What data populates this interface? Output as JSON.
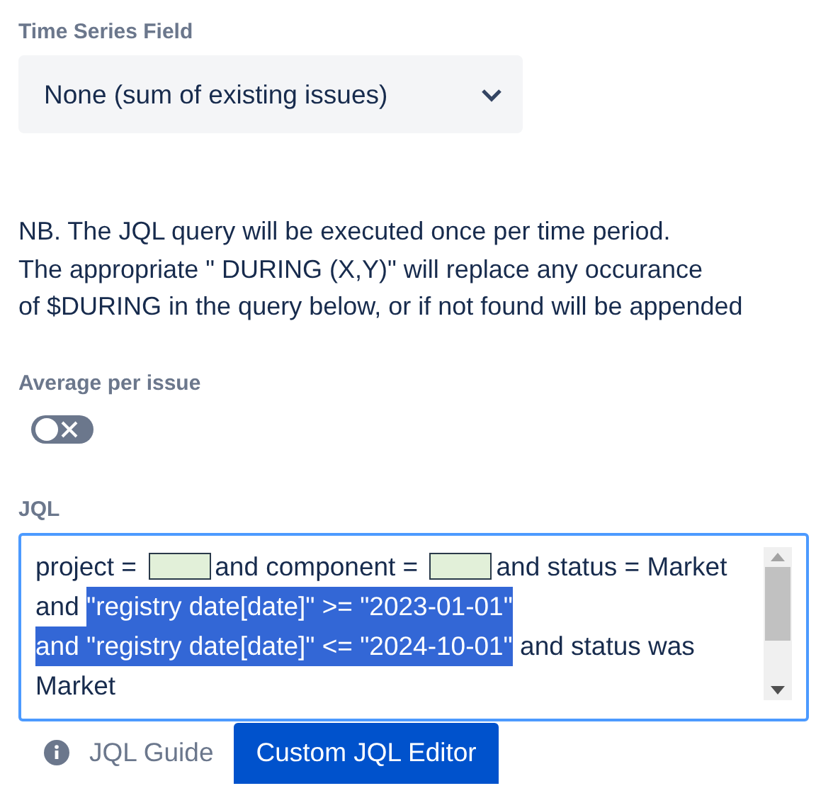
{
  "time_series": {
    "label": "Time Series Field",
    "value": "None (sum of existing issues)"
  },
  "note": [
    "NB. The JQL query will be executed once per time period.",
    "The appropriate \" DURING (X,Y)\" will replace any occurance",
    "of $DURING in the query below, or if not found will be appended"
  ],
  "average": {
    "label": "Average per issue",
    "on": false
  },
  "jql": {
    "label": "JQL",
    "lines": [
      [
        {
          "kind": "text",
          "text": "project = ",
          "selected": false
        },
        {
          "kind": "redacted",
          "selected": false
        },
        {
          "kind": "text",
          "text": "and component = ",
          "selected": false
        },
        {
          "kind": "redacted",
          "selected": false
        },
        {
          "kind": "text",
          "text": "and status = Market",
          "selected": false
        }
      ],
      [
        {
          "kind": "text",
          "text": "and ",
          "selected": false
        },
        {
          "kind": "text",
          "text": "\"registry date[date]\" >= \"2023-01-01\"",
          "selected": true
        }
      ],
      [
        {
          "kind": "text",
          "text": "and \"registry date[date]\" <= \"2024-10-01\"",
          "selected": true
        },
        {
          "kind": "text",
          "text": " and status was",
          "selected": false
        }
      ],
      [
        {
          "kind": "text",
          "text": "Market",
          "selected": false
        }
      ]
    ]
  },
  "guide_link": "JQL Guide",
  "editor_button": "Custom JQL Editor"
}
